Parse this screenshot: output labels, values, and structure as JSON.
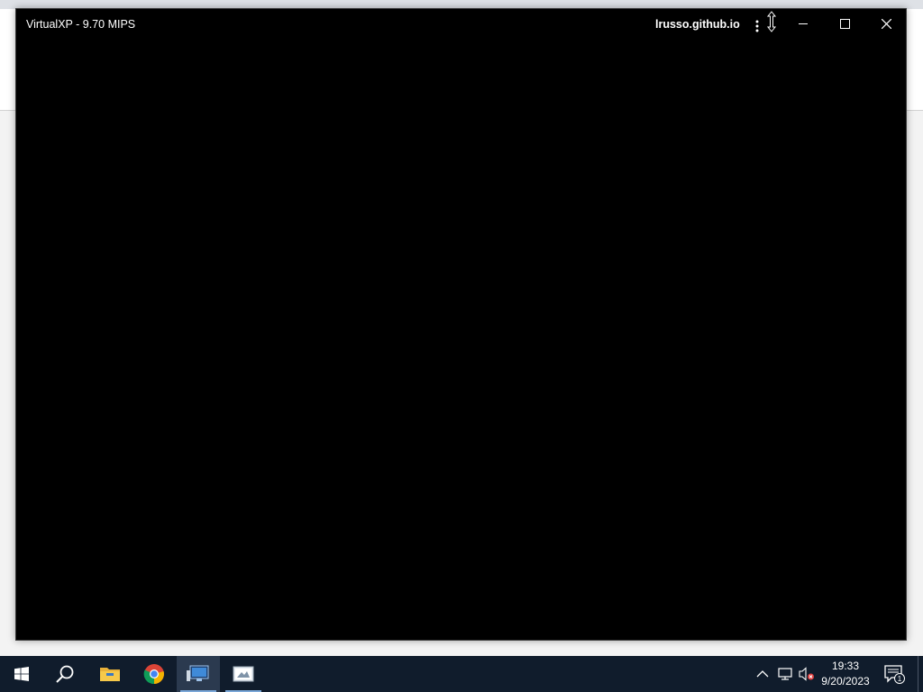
{
  "window": {
    "title": "VirtualXP - 9.70 MIPS",
    "origin": "lrusso.github.io",
    "menu_icon": "more-vertical-icon",
    "minimize_icon": "minimize-icon",
    "maximize_icon": "maximize-icon",
    "close_icon": "close-icon"
  },
  "taskbar": {
    "start_icon": "windows-logo-icon",
    "search_icon": "search-icon",
    "pinned": [
      {
        "name": "file-explorer",
        "icon": "folder-icon"
      },
      {
        "name": "google-chrome",
        "icon": "chrome-icon"
      },
      {
        "name": "virtualxp",
        "icon": "vm-icon",
        "active": true
      },
      {
        "name": "snipping-tool",
        "icon": "screenshot-icon"
      }
    ],
    "tray": {
      "time": "19:33",
      "date": "9/20/2023",
      "notifications_count": "1"
    }
  },
  "colors": {
    "taskbar_bg": "#101c2c",
    "window_bg": "#000000",
    "title_text": "#ffffff"
  }
}
